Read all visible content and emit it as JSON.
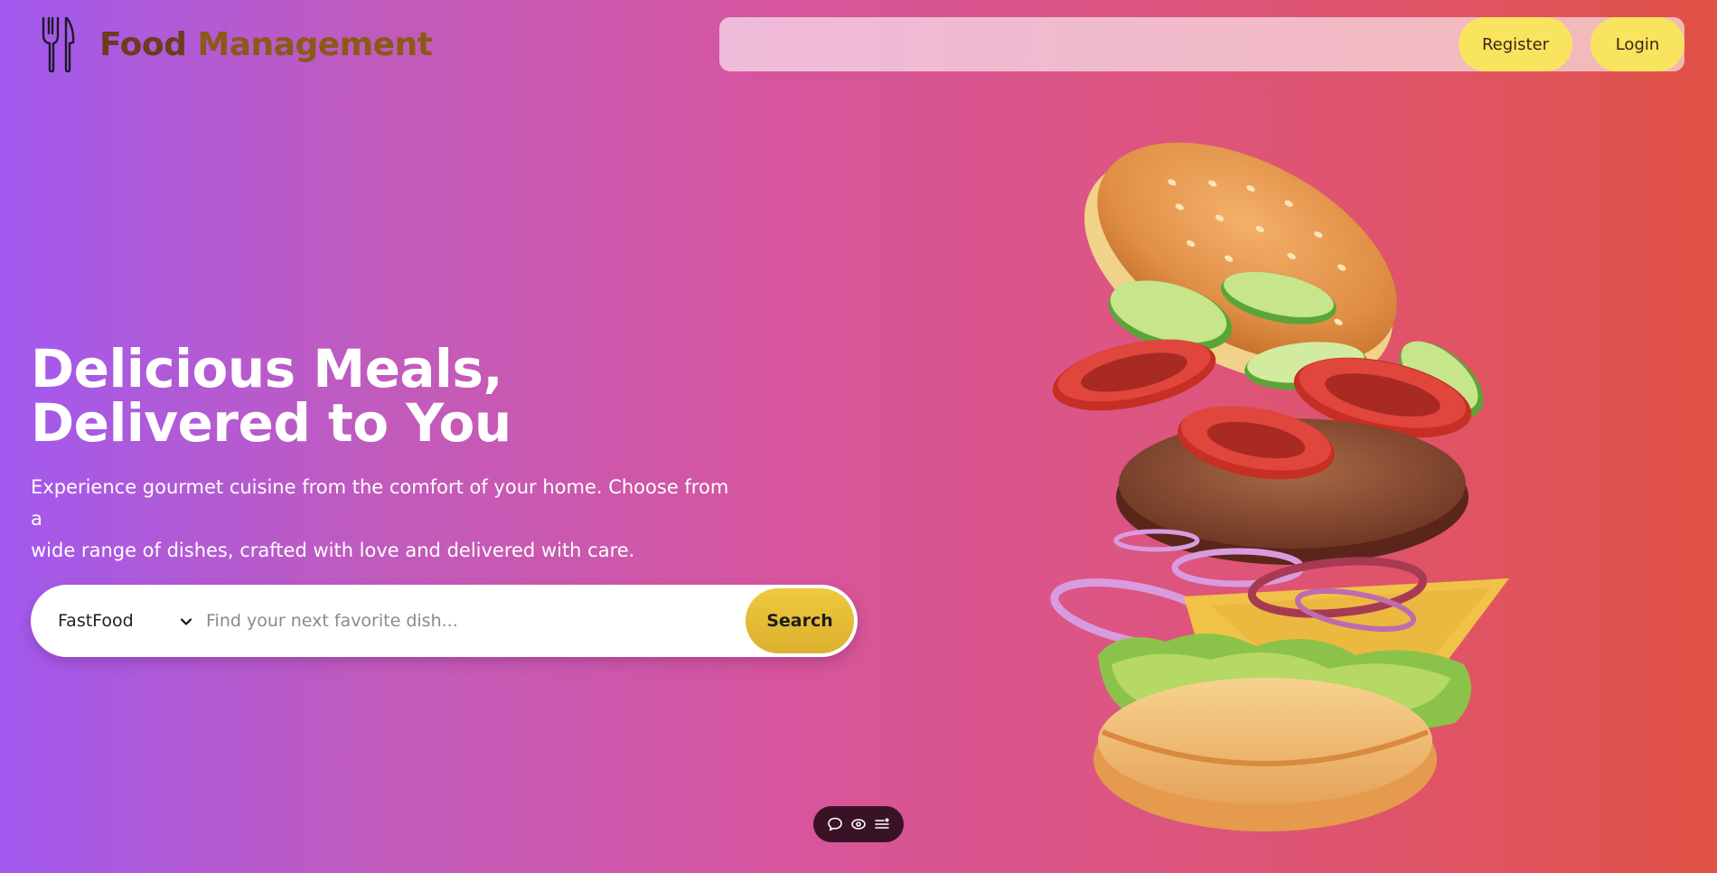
{
  "brand": {
    "title_part1": "Food",
    "title_part2": "Management",
    "logo_icon": "fork-knife-icon"
  },
  "nav": {
    "register_label": "Register",
    "login_label": "Login"
  },
  "hero": {
    "headline_line1": "Delicious Meals,",
    "headline_line2": "Delivered to You",
    "description_line1": "Experience gourmet cuisine from the comfort of your home. Choose from a",
    "description_line2": "wide range of dishes, crafted with love and delivered with care."
  },
  "search": {
    "category_selected": "FastFood",
    "placeholder": "Find your next favorite dish...",
    "button_label": "Search"
  },
  "dock": {
    "icons": [
      "chat-bubble-icon",
      "eye-icon",
      "list-menu-icon"
    ]
  },
  "colors": {
    "gradient_start": "#a259ee",
    "gradient_end": "#e05144",
    "button_yellow": "#f9e460",
    "brand_brown": "#6b3d1d",
    "brand_accent": "#8a5a18"
  }
}
